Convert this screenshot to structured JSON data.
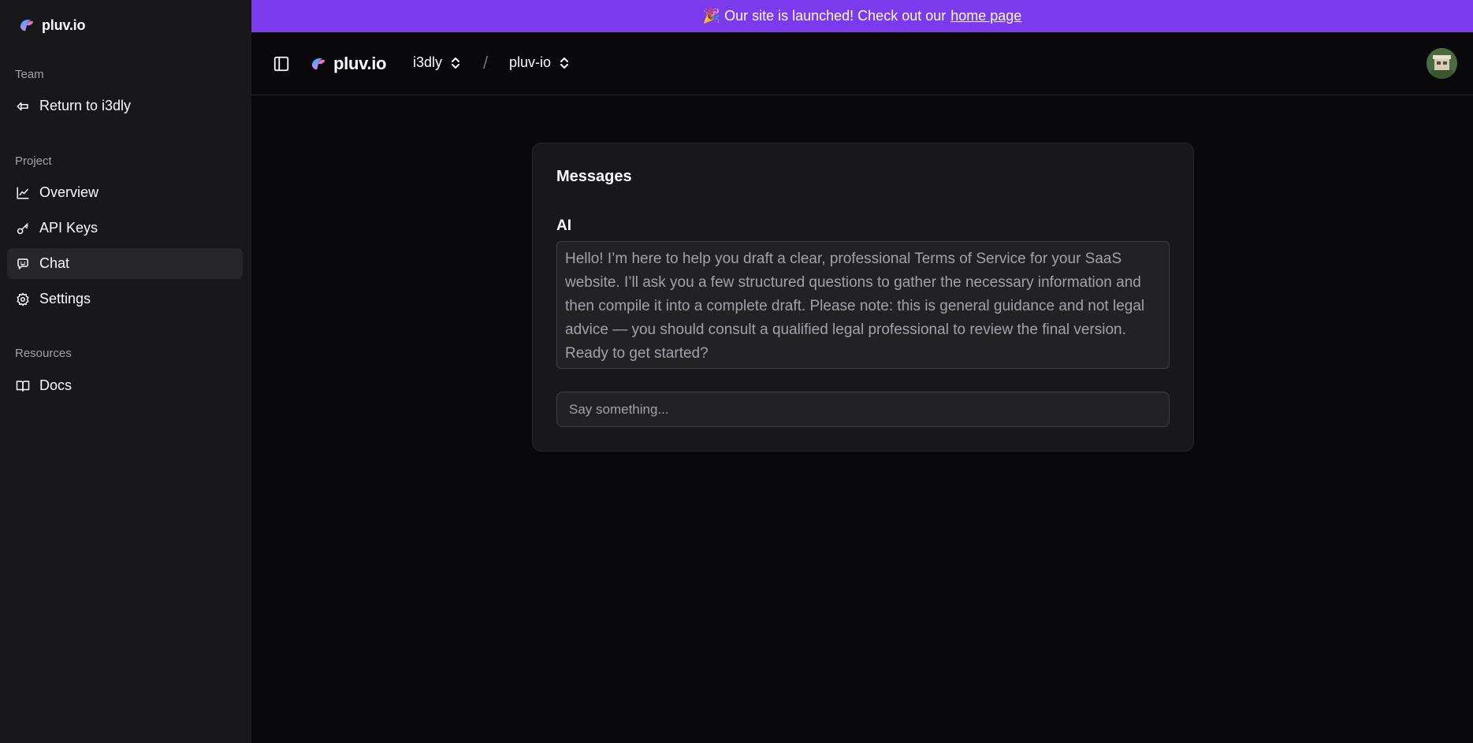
{
  "sidebar": {
    "brand": "pluv.io",
    "sections": {
      "team": "Team",
      "project": "Project",
      "resources": "Resources"
    },
    "items": {
      "return": "Return to i3dly",
      "overview": "Overview",
      "api_keys": "API Keys",
      "chat": "Chat",
      "settings": "Settings",
      "docs": "Docs"
    },
    "active_item": "Chat"
  },
  "banner": {
    "text": "🎉 Our site is launched! Check out our",
    "link": "home page"
  },
  "header": {
    "brand": "pluv.io",
    "team_switcher": "i3dly",
    "separator": "/",
    "project_switcher": "pluv-io"
  },
  "card": {
    "title": "Messages",
    "messages": [
      {
        "sender": "AI",
        "text": "Hello! I’m here to help you draft a clear, professional Terms of Service for your SaaS website. I’ll ask you a few structured questions to gather the necessary information and then compile it into a complete draft. Please note: this is general guidance and not legal advice — you should consult a qualified legal professional to review the final version. Ready to get started?"
      }
    ],
    "input_placeholder": "Say something..."
  },
  "colors": {
    "banner": "#7c3aed",
    "sidebar_bg": "#18181b",
    "page_bg": "#09090b",
    "active_item_bg": "#27272a"
  },
  "icons": [
    "logo-icon",
    "return-icon",
    "chart-line-icon",
    "key-icon",
    "chat-icon",
    "gear-icon",
    "book-icon",
    "sidebar-toggle-icon",
    "chevrons-up-down-icon"
  ]
}
